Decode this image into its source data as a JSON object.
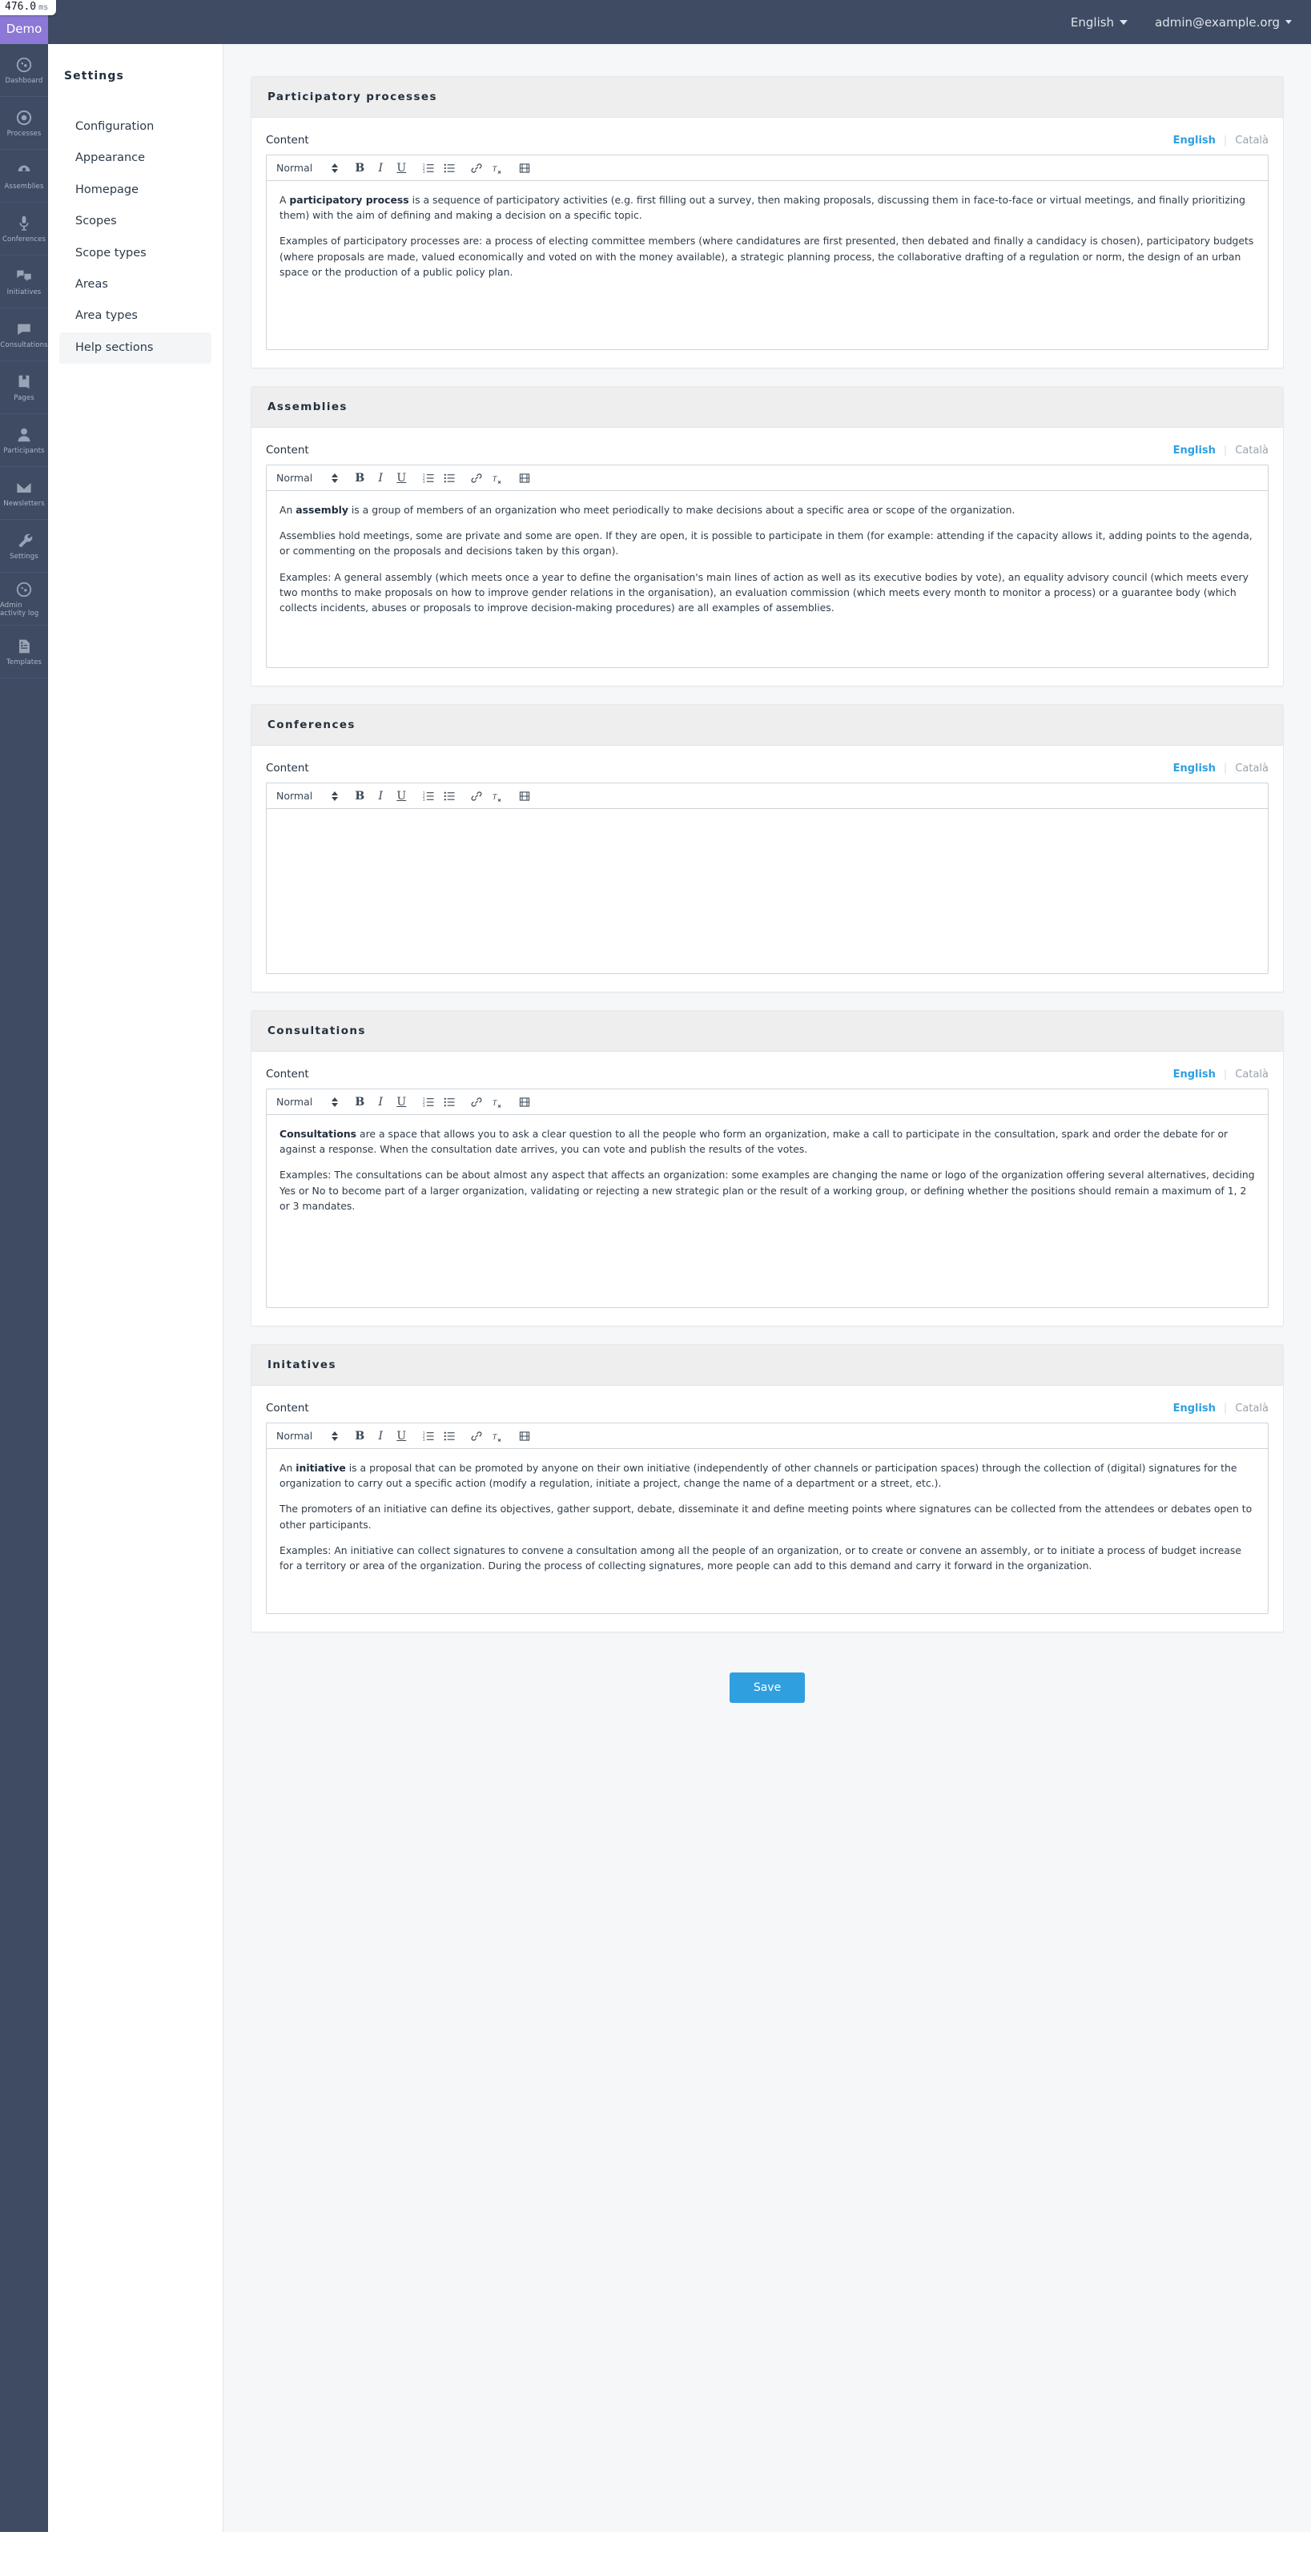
{
  "perf": {
    "value": "476.0",
    "unit": "ms"
  },
  "brand": {
    "label": "Demo"
  },
  "topbar": {
    "language": "English",
    "account": "admin@example.org"
  },
  "rail": {
    "items": [
      {
        "label": "Dashboard",
        "icon": "dashboard-icon"
      },
      {
        "label": "Processes",
        "icon": "target-icon"
      },
      {
        "label": "Assemblies",
        "icon": "assembly-icon"
      },
      {
        "label": "Conferences",
        "icon": "microphone-icon"
      },
      {
        "label": "Initiatives",
        "icon": "speech-bubbles-icon"
      },
      {
        "label": "Consultations",
        "icon": "speech-bubble-icon"
      },
      {
        "label": "Pages",
        "icon": "book-icon"
      },
      {
        "label": "Participants",
        "icon": "user-icon"
      },
      {
        "label": "Newsletters",
        "icon": "envelope-icon"
      },
      {
        "label": "Settings",
        "icon": "wrench-icon"
      },
      {
        "label": "Admin activity log",
        "icon": "clock-icon"
      },
      {
        "label": "Templates",
        "icon": "document-icon"
      }
    ]
  },
  "subnav": {
    "title": "Settings",
    "items": [
      {
        "label": "Configuration",
        "active": false
      },
      {
        "label": "Appearance",
        "active": false
      },
      {
        "label": "Homepage",
        "active": false
      },
      {
        "label": "Scopes",
        "active": false
      },
      {
        "label": "Scope types",
        "active": false
      },
      {
        "label": "Areas",
        "active": false
      },
      {
        "label": "Area types",
        "active": false
      },
      {
        "label": "Help sections",
        "active": true
      }
    ]
  },
  "editor_toolbar": {
    "format": "Normal",
    "buttons": [
      {
        "name": "bold-icon",
        "glyph": "B"
      },
      {
        "name": "italic-icon",
        "glyph": "I"
      },
      {
        "name": "underline-icon",
        "glyph": "U"
      },
      {
        "name": "ordered-list-icon",
        "glyph": ""
      },
      {
        "name": "bullet-list-icon",
        "glyph": ""
      },
      {
        "name": "link-icon",
        "glyph": ""
      },
      {
        "name": "clear-format-icon",
        "glyph": ""
      },
      {
        "name": "video-icon",
        "glyph": ""
      }
    ]
  },
  "labels": {
    "content": "Content",
    "lang_english": "English",
    "lang_catala": "Català"
  },
  "colors": {
    "accent": "#2f9fe0",
    "topbar": "#3e4b63",
    "brand_tile": "#8c78d6",
    "card_head": "#eeeeee",
    "page_bg": "#f6f7f8"
  },
  "sections": [
    {
      "title": "Participatory processes",
      "paragraphs": [
        {
          "lead": "A ",
          "bold": "participatory process",
          "rest": " is a sequence of participatory activities (e.g. first filling out a survey, then making proposals, discussing them in face-to-face or virtual meetings, and finally prioritizing them) with the aim of defining and making a decision on a specific topic."
        },
        {
          "lead": "",
          "bold": "",
          "rest": "Examples of participatory processes are: a process of electing committee members (where candidatures are first presented, then debated and finally a candidacy is chosen), participatory budgets (where proposals are made, valued economically and voted on with the money available), a strategic planning process, the collaborative drafting of a regulation or norm, the design of an urban space or the production of a public policy plan."
        }
      ]
    },
    {
      "title": "Assemblies",
      "paragraphs": [
        {
          "lead": "An ",
          "bold": "assembly",
          "rest": " is a group of members of an organization who meet periodically to make decisions about a specific area or scope of the organization."
        },
        {
          "lead": "",
          "bold": "",
          "rest": "Assemblies hold meetings, some are private and some are open. If they are open, it is possible to participate in them (for example: attending if the capacity allows it, adding points to the agenda, or commenting on the proposals and decisions taken by this organ)."
        },
        {
          "lead": "",
          "bold": "",
          "rest": "Examples: A general assembly (which meets once a year to define the organisation's main lines of action as well as its executive bodies by vote), an equality advisory council (which meets every two months to make proposals on how to improve gender relations in the organisation), an evaluation commission (which meets every month to monitor a process) or a guarantee body (which collects incidents, abuses or proposals to improve decision-making procedures) are all examples of assemblies."
        }
      ]
    },
    {
      "title": "Conferences",
      "paragraphs": []
    },
    {
      "title": "Consultations",
      "paragraphs": [
        {
          "lead": "",
          "bold": "Consultations",
          "rest": " are a space that allows you to ask a clear question to all the people who form an organization, make a call to participate in the consultation, spark and order the debate for or against a response. When the consultation date arrives, you can vote and publish the results of the votes."
        },
        {
          "lead": "",
          "bold": "",
          "rest": "Examples: The consultations can be about almost any aspect that affects an organization: some examples are changing the name or logo of the organization offering several alternatives, deciding Yes or No to become part of a larger organization, validating or rejecting a new strategic plan or the result of a working group, or defining whether the positions should remain a maximum of 1, 2 or 3 mandates."
        }
      ]
    },
    {
      "title": "Initatives",
      "paragraphs": [
        {
          "lead": "An ",
          "bold": "initiative",
          "rest": " is a proposal that can be promoted by anyone on their own initiative (independently of other channels or participation spaces) through the collection of (digital) signatures for the organization to carry out a specific action (modify a regulation, initiate a project, change the name of a department or a street, etc.)."
        },
        {
          "lead": "",
          "bold": "",
          "rest": "The promoters of an initiative can define its objectives, gather support, debate, disseminate it and define meeting points where signatures can be collected from the attendees or debates open to other participants."
        },
        {
          "lead": "",
          "bold": "",
          "rest": "Examples: An initiative can collect signatures to convene a consultation among all the people of an organization, or to create or convene an assembly, or to initiate a process of budget increase for a territory or area of the organization. During the process of collecting signatures, more people can add to this demand and carry it forward in the organization."
        }
      ]
    }
  ],
  "editor_heights": [
    210,
    220,
    205,
    240,
    205
  ],
  "footer": {
    "save_label": "Save"
  }
}
